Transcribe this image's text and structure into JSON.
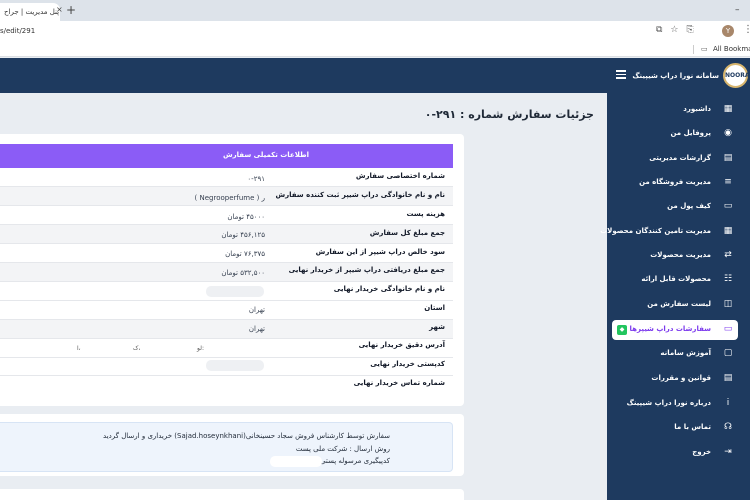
{
  "browser": {
    "tab_title": "پنل مدیریت | جراح",
    "tab_close": "×",
    "new_tab": "+",
    "minimize": "–",
    "url": "s/edit/291",
    "addr_icons": "⧉☆⎘",
    "profile_initial": "Y",
    "menu": "⋮",
    "bookmarks_label": "All Bookmarks",
    "bookmarks_icon": "folder-icon"
  },
  "sidebar": {
    "logo_text": "NOORA",
    "brand": "سامانه نورا دراپ شیپینگ",
    "items": [
      {
        "label": "داشبورد",
        "icon": "▦"
      },
      {
        "label": "پروفایل من",
        "icon": "◉"
      },
      {
        "label": "گزارشات مدیریتی",
        "icon": "▤"
      },
      {
        "label": "مدیریت فروشگاه من",
        "icon": "≡"
      },
      {
        "label": "کیف پول من",
        "icon": "▭"
      },
      {
        "label": "مدیریت تامین کنندگان محصولات",
        "icon": "▦"
      },
      {
        "label": "مدیریت محصولات",
        "icon": "⇄"
      },
      {
        "label": "محصولات قابل ارائه",
        "icon": "☷"
      },
      {
        "label": "لیست سفارش من",
        "icon": "◫"
      },
      {
        "label": "سفارشات دراپ شیپرها",
        "icon": "▭",
        "badge": "◆"
      },
      {
        "label": "آموزش سامانه",
        "icon": "▢"
      },
      {
        "label": "قوانین و مقررات",
        "icon": "▤"
      },
      {
        "label": "درباره نورا دراپ شیپینگ",
        "icon": "i"
      },
      {
        "label": "تماس با ما",
        "icon": "☊"
      },
      {
        "label": "خروج",
        "icon": "⇥"
      }
    ]
  },
  "main": {
    "title": "جزئیات سفارش شماره : ۲۹۱-۰",
    "card_header": "اطلاعات تکمیلی سفارش",
    "rows": [
      {
        "label": "شماره اختصاصی سفارش",
        "value": "۰-۲۹۱"
      },
      {
        "label": "نام و نام خانوادگی دراپ شیپر ثبت کننده سفارش",
        "value": "ر ( Negrooperfume )"
      },
      {
        "label": "هزینه پست",
        "value": "۴۵۰۰۰ تومان"
      },
      {
        "label": "جمع مبلغ کل سفارش",
        "value": "۴۵۶,۱۲۵ تومان"
      },
      {
        "label": "سود خالص دراپ شیپر از این سفارش",
        "value": "۷۶,۳۷۵ تومان"
      },
      {
        "label": "جمع مبلغ دریافتی دراپ شیپر از خریدار نهایی",
        "value": "۵۳۲,۵۰۰ تومان"
      },
      {
        "label": "نام و نام خانوادگی خریدار نهایی",
        "value": ""
      },
      {
        "label": "استان",
        "value": "تهران"
      },
      {
        "label": "شهر",
        "value": "تهران"
      },
      {
        "label": "آدرس دقیق خریدار نهایی",
        "value": ""
      },
      {
        "label": "کدپستی خریدار نهایی",
        "value": ""
      },
      {
        "label": "شماره تماس خریدار نهایی",
        "value": ""
      }
    ],
    "address_fragments": [
      "لو:",
      "ک،",
      "ا،"
    ],
    "note": {
      "line1": "سفارش توسط کارشناس فروش سجاد حسینخانی(Sajad.hoseynkhani) خریداری و ارسال گردید",
      "line2": "روش ارسال : شرکت ملی پست",
      "line3": "کدپیگیری مرسوله پستی : ۰۷۹۳۰۰۰۰۱۱۴"
    }
  }
}
